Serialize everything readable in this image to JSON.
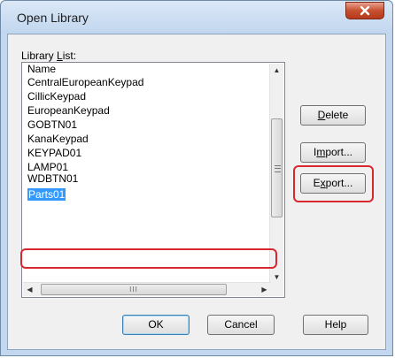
{
  "window": {
    "title": "Open Library",
    "close_glyph": "✕"
  },
  "library": {
    "label_prefix": "Library ",
    "label_mnemonic": "L",
    "label_suffix": "ist:",
    "column_header": "Name",
    "items": [
      "CentralEuropeanKeypad",
      "CillicKeypad",
      "EuropeanKeypad",
      "GOBTN01",
      "KanaKeypad",
      "KEYPAD01",
      "LAMP01",
      "WDBTN01",
      "Parts01"
    ],
    "selected_item": "Parts01",
    "hscroll_grip": "III"
  },
  "side_buttons": {
    "delete_mnemonic": "D",
    "delete_rest": "elete",
    "import_prefix": "I",
    "import_mnemonic": "m",
    "import_rest": "port...",
    "export_prefix": "E",
    "export_mnemonic": "x",
    "export_rest": "port..."
  },
  "bottom_buttons": {
    "ok": "OK",
    "cancel": "Cancel",
    "help": "Help"
  },
  "colors": {
    "selection": "#3399ff",
    "annotation": "#d7282f",
    "close_button": "#c7502f"
  }
}
